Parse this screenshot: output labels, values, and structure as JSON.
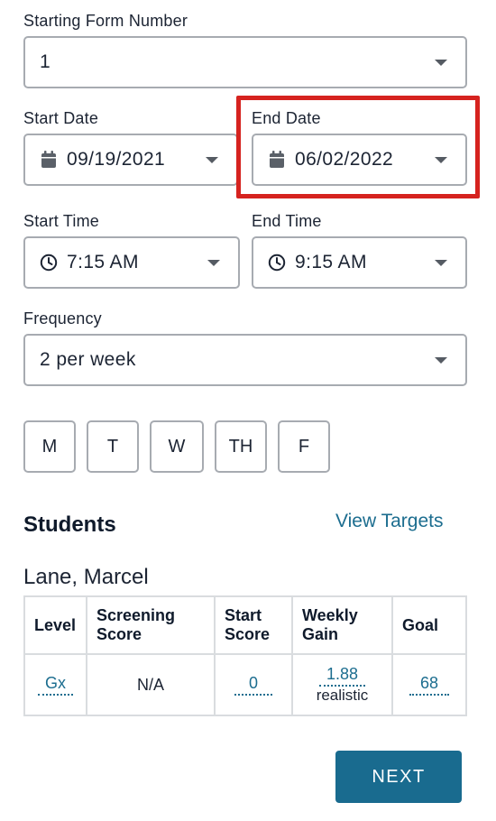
{
  "form_number": {
    "label": "Starting Form Number",
    "value": "1"
  },
  "start_date": {
    "label": "Start Date",
    "value": "09/19/2021",
    "icon": "calendar-icon"
  },
  "end_date": {
    "label": "End Date",
    "value": "06/02/2022",
    "icon": "calendar-icon"
  },
  "start_time": {
    "label": "Start Time",
    "value": "7:15 AM",
    "icon": "clock-icon"
  },
  "end_time": {
    "label": "End Time",
    "value": "9:15 AM",
    "icon": "clock-icon"
  },
  "frequency": {
    "label": "Frequency",
    "value": "2 per week"
  },
  "days": [
    "M",
    "T",
    "W",
    "TH",
    "F"
  ],
  "students": {
    "heading": "Students",
    "view_targets": "View Targets",
    "student_name": "Lane, Marcel",
    "columns": [
      "Level",
      "Screening Score",
      "Start Score",
      "Weekly Gain",
      "Goal"
    ],
    "row": {
      "level": "Gx",
      "screening_score": "N/A",
      "start_score": "0",
      "weekly_gain": "1.88",
      "weekly_gain_note": "realistic",
      "goal": "68"
    }
  },
  "next_label": "NEXT",
  "colors": {
    "accent": "#196b8f",
    "link": "#1c6d8f",
    "highlight": "#d6231f",
    "border": "#a7abb1"
  }
}
